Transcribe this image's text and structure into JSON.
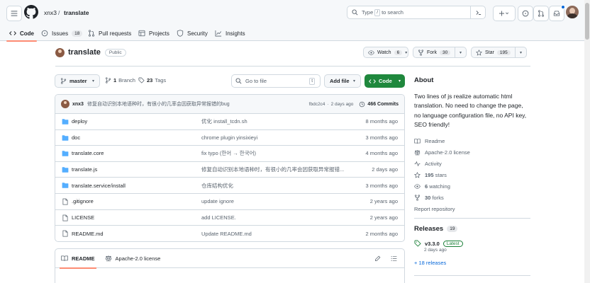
{
  "header": {
    "owner": "xnx3",
    "separator": "/",
    "repo": "translate",
    "search_prefix": "Type",
    "search_key": "/",
    "search_suffix": "to search"
  },
  "tabs": [
    {
      "label": "Code"
    },
    {
      "label": "Issues",
      "count": "18"
    },
    {
      "label": "Pull requests"
    },
    {
      "label": "Projects"
    },
    {
      "label": "Security"
    },
    {
      "label": "Insights"
    }
  ],
  "repo": {
    "name": "translate",
    "visibility": "Public",
    "watch_label": "Watch",
    "watch_count": "6",
    "fork_label": "Fork",
    "fork_count": "30",
    "star_label": "Star",
    "star_count": "195"
  },
  "filenav": {
    "branch": "master",
    "branch_count": "1",
    "branch_label": "Branch",
    "tag_count": "23",
    "tag_label": "Tags",
    "goto_placeholder": "Go to file",
    "goto_key": "t",
    "add_file": "Add file",
    "code": "Code"
  },
  "commit": {
    "author": "xnx3",
    "message": "修复自动识别本地语种时，有很小的几率会因获取异常报错的bug",
    "hash": "fbdc2c4",
    "dot": "·",
    "time": "2 days ago",
    "commits": "466 Commits"
  },
  "files": [
    {
      "name": "deploy",
      "type": "dir",
      "message": "优化 install_tcdn.sh",
      "age": "8 months ago"
    },
    {
      "name": "doc",
      "type": "dir",
      "message": "chrome plugin yinsixieyi",
      "age": "3 months ago"
    },
    {
      "name": "translate.core",
      "type": "dir",
      "message": "fix typo (한어 → 한국어)",
      "age": "4 months ago"
    },
    {
      "name": "translate.js",
      "type": "dir",
      "message": "修复自动识别本地语种时，有很小的几率会因获取异常报错...",
      "age": "2 days ago"
    },
    {
      "name": "translate.service/install",
      "type": "dir",
      "message": "仓库结构优化",
      "age": "3 months ago"
    },
    {
      "name": ".gitignore",
      "type": "file",
      "message": "update ignore",
      "age": "2 years ago"
    },
    {
      "name": "LICENSE",
      "type": "file",
      "message": "add LICENSE.",
      "age": "2 years ago"
    },
    {
      "name": "README.md",
      "type": "file",
      "message": "Update README.md",
      "age": "2 months ago"
    }
  ],
  "readme": {
    "tab1": "README",
    "tab2": "Apache-2.0 license"
  },
  "about": {
    "title": "About",
    "description": "Two lines of js realize automatic html translation. No need to change the page, no language configuration file, no API key, SEO friendly!",
    "readme": "Readme",
    "license": "Apache-2.0 license",
    "activity": "Activity",
    "stars": "195",
    "stars_label": "stars",
    "watching": "6",
    "watching_label": "watching",
    "forks": "30",
    "forks_label": "forks",
    "report": "Report repository"
  },
  "releases": {
    "title": "Releases",
    "count": "19",
    "version": "v3.3.0",
    "latest": "Latest",
    "date": "2 days ago",
    "more": "+ 18 releases"
  },
  "colors": {
    "accent_underline": "#fd8c73",
    "primary_green": "#1f883d",
    "folder_blue": "#54aeff",
    "link_blue": "#0969da"
  }
}
